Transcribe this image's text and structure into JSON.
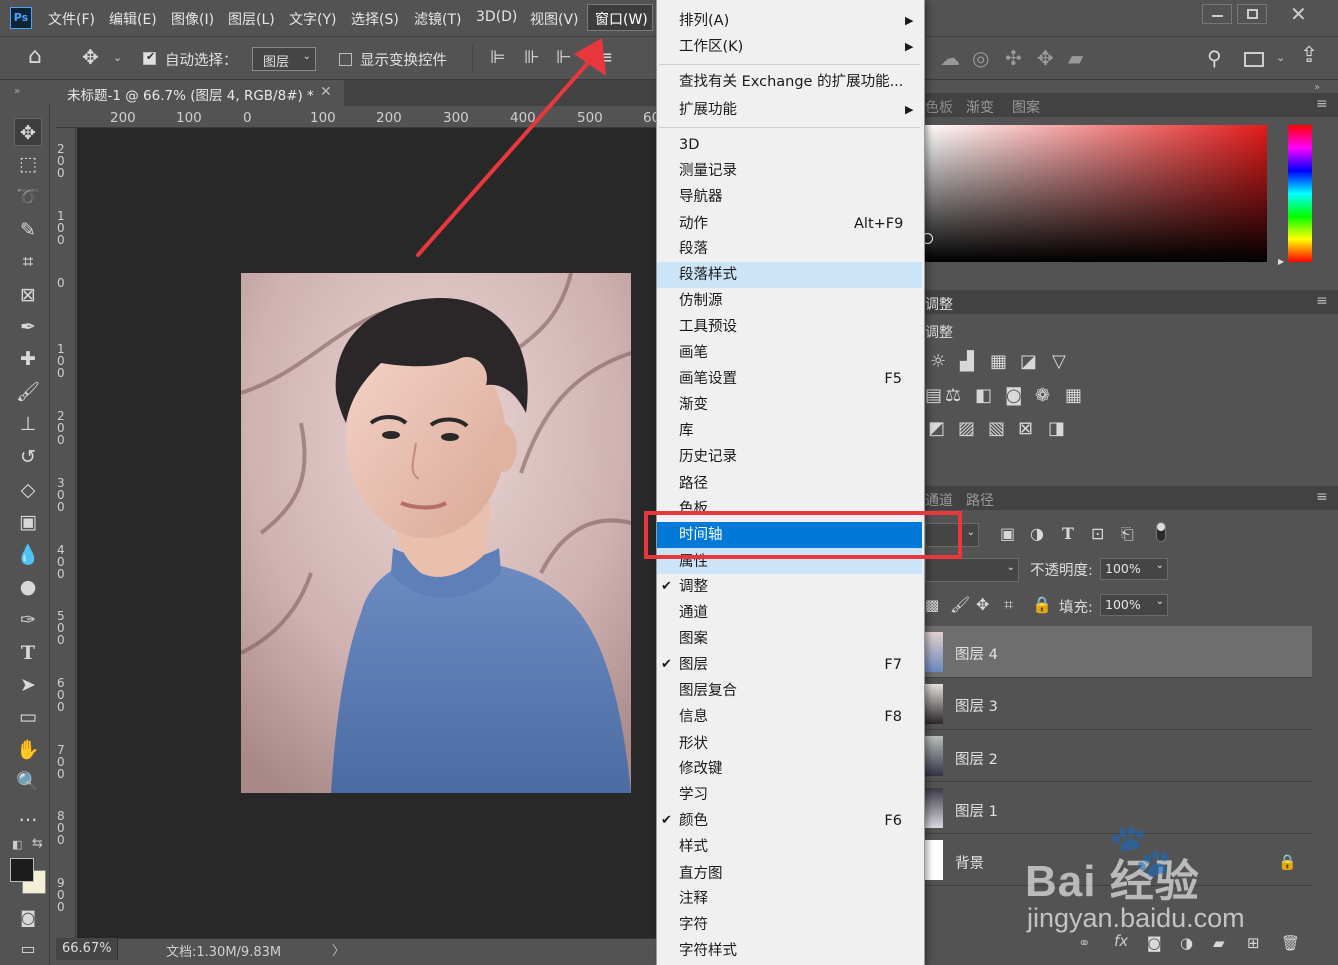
{
  "app": {
    "logo": "Ps",
    "menus": [
      "文件(F)",
      "编辑(E)",
      "图像(I)",
      "图层(L)",
      "文字(Y)",
      "选择(S)",
      "滤镜(T)",
      "3D(D)",
      "视图(V)",
      "窗口(W)"
    ],
    "window_controls": [
      "minimize-icon",
      "restore-icon",
      "close-icon"
    ]
  },
  "options_bar": {
    "auto_select_label": "自动选择：",
    "auto_select_target": "图层",
    "show_transform_label": "显示变换控件"
  },
  "document": {
    "tab_title": "未标题-1 @ 66.7% (图层 4, RGB/8#) *",
    "ruler_top_labels": [
      "200",
      "100",
      "0",
      "100",
      "200",
      "300",
      "400",
      "500",
      "60"
    ],
    "ruler_left_labels": [
      "200",
      "100",
      "0",
      "100",
      "200",
      "300",
      "400",
      "500",
      "600",
      "700",
      "800",
      "900"
    ],
    "zoom": "66.67%",
    "doc_info": "文档:1.30M/9.83M"
  },
  "window_menu": {
    "items": [
      {
        "label": "排列(A)",
        "submenu": true
      },
      {
        "label": "工作区(K)",
        "submenu": true
      },
      {
        "separator": true
      },
      {
        "label": "查找有关 Exchange 的扩展功能..."
      },
      {
        "label": "扩展功能",
        "submenu": true
      },
      {
        "separator": true
      },
      {
        "label": "3D"
      },
      {
        "label": "测量记录"
      },
      {
        "label": "导航器"
      },
      {
        "label": "动作",
        "shortcut": "Alt+F9"
      },
      {
        "label": "段落"
      },
      {
        "label": "段落样式",
        "hover": true
      },
      {
        "label": "仿制源"
      },
      {
        "label": "工具预设"
      },
      {
        "label": "画笔"
      },
      {
        "label": "画笔设置",
        "shortcut": "F5"
      },
      {
        "label": "渐变"
      },
      {
        "label": "库"
      },
      {
        "label": "历史记录"
      },
      {
        "label": "路径"
      },
      {
        "label": "色板"
      },
      {
        "label": "时间轴",
        "selected": true
      },
      {
        "label": "属性"
      },
      {
        "label": "调整",
        "checked": true
      },
      {
        "label": "通道"
      },
      {
        "label": "图案"
      },
      {
        "label": "图层",
        "shortcut": "F7",
        "checked": true
      },
      {
        "label": "图层复合"
      },
      {
        "label": "信息",
        "shortcut": "F8"
      },
      {
        "label": "形状"
      },
      {
        "label": "修改键"
      },
      {
        "label": "学习"
      },
      {
        "label": "颜色",
        "shortcut": "F6",
        "checked": true
      },
      {
        "label": "样式"
      },
      {
        "label": "直方图"
      },
      {
        "label": "注释"
      },
      {
        "label": "字符"
      },
      {
        "label": "字符样式"
      }
    ]
  },
  "panels": {
    "color_tabs": [
      "色板",
      "渐变",
      "图案"
    ],
    "adjust_tab": "调整",
    "adjust_title": "调整",
    "layers_tabs": [
      "通道",
      "路径"
    ],
    "opacity_label": "不透明度:",
    "opacity_value": "100%",
    "fill_label": "填充:",
    "fill_value": "100%",
    "layers": [
      {
        "name": "图层 4",
        "selected": true
      },
      {
        "name": "图层 3"
      },
      {
        "name": "图层 2"
      },
      {
        "name": "图层 1"
      },
      {
        "name": "背景",
        "locked": true
      }
    ]
  },
  "watermark": {
    "brand": "Bai 经验",
    "url": "jingyan.baidu.com"
  },
  "colors": {
    "highlight_box": "#e8383d",
    "menu_selected": "#0078d7",
    "menu_hover": "#cce4f7",
    "arrow": "#e8383d"
  }
}
